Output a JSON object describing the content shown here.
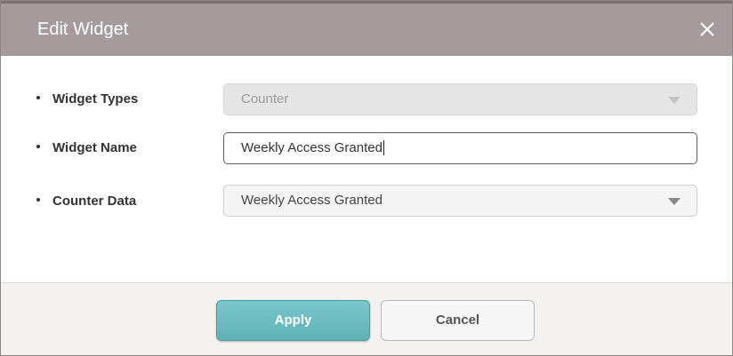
{
  "dialog": {
    "title": "Edit Widget",
    "close_icon": "close-icon"
  },
  "form": {
    "widget_types": {
      "label": "Widget Types",
      "value": "Counter",
      "disabled": true
    },
    "widget_name": {
      "label": "Widget Name",
      "value": "Weekly Access Granted"
    },
    "counter_data": {
      "label": "Counter Data",
      "value": "Weekly Access Granted"
    }
  },
  "footer": {
    "apply_label": "Apply",
    "cancel_label": "Cancel"
  },
  "colors": {
    "titlebar": "#a59b9c",
    "apply_button": "#6cbcc1"
  }
}
